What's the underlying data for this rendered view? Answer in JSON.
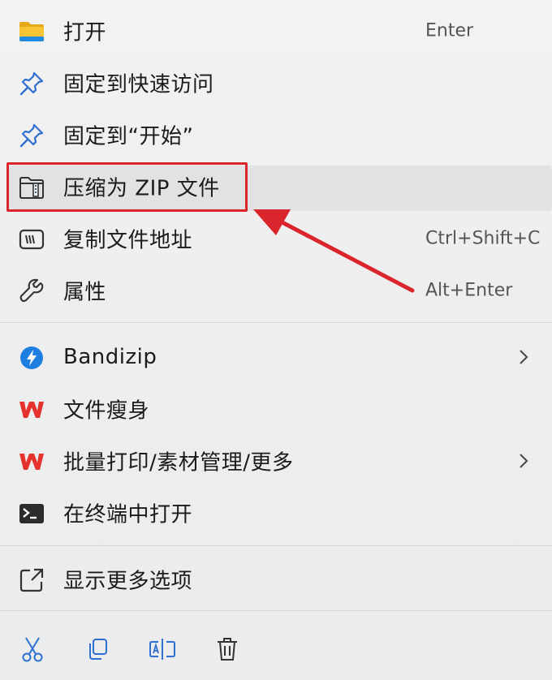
{
  "menu": {
    "items": [
      {
        "label": "打开",
        "shortcut": "Enter",
        "icon": "folder-icon"
      },
      {
        "label": "固定到快速访问",
        "shortcut": "",
        "icon": "pin-icon"
      },
      {
        "label": "固定到“开始”",
        "shortcut": "",
        "icon": "pin-icon"
      },
      {
        "label": "压缩为 ZIP 文件",
        "shortcut": "",
        "icon": "zip-folder-icon"
      },
      {
        "label": "复制文件地址",
        "shortcut": "Ctrl+Shift+C",
        "icon": "copy-path-icon"
      },
      {
        "label": "属性",
        "shortcut": "Alt+Enter",
        "icon": "wrench-icon"
      },
      {
        "label": "Bandizip",
        "shortcut": "",
        "icon": "bandizip-icon",
        "submenu": true
      },
      {
        "label": "文件瘦身",
        "shortcut": "",
        "icon": "wps-icon"
      },
      {
        "label": "批量打印/素材管理/更多",
        "shortcut": "",
        "icon": "wps-icon",
        "submenu": true
      },
      {
        "label": "在终端中打开",
        "shortcut": "",
        "icon": "terminal-icon"
      },
      {
        "label": "显示更多选项",
        "shortcut": "",
        "icon": "show-more-icon"
      }
    ]
  },
  "bottom_actions": [
    "cut-icon",
    "copy-icon",
    "rename-icon",
    "delete-icon"
  ],
  "colors": {
    "highlight_box": "#d9252b",
    "arrow": "#d9252b",
    "wps_red": "#e5322d",
    "bandizip_blue": "#1f7fe0",
    "pin_blue": "#2f6fd0"
  }
}
